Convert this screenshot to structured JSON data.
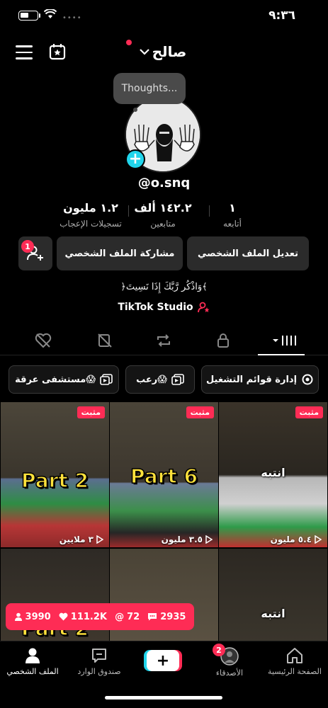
{
  "status_bar": {
    "time": "٩:٣٦"
  },
  "header": {
    "username": "صالح"
  },
  "profile": {
    "thought_bubble": "Thoughts...",
    "handle": "@o.snq",
    "bio": "﴿وَاذْكُر رَّبَّكَ إِذَا نَسِيتَ﴾",
    "studio": "TikTok Studio"
  },
  "stats": [
    {
      "value": "١",
      "label": "أتابعه"
    },
    {
      "value": "١٤٢.٢ ألف",
      "label": "متابعين"
    },
    {
      "value": "١.٢ مليون",
      "label": "تسجيلات الإعجاب"
    }
  ],
  "buttons": {
    "edit_profile": "تعديل الملف الشخصي",
    "share_profile": "مشاركة الملف الشخصي",
    "add_friend_badge": "1"
  },
  "playlists": {
    "manage": "إدارة قوائم التشغيل",
    "horror": "رعب😱",
    "hospital": "مستشفى عرقة😱"
  },
  "videos": [
    {
      "pinned": "مثبت",
      "overlay": "انتبه",
      "views": "٥.٤ مليون"
    },
    {
      "pinned": "مثبت",
      "overlay": "Part 6",
      "views": "٣.٥ مليون"
    },
    {
      "pinned": "مثبت",
      "overlay": "Part 2",
      "views": "٣ ملايين"
    },
    {
      "overlay": "انتبه"
    },
    {
      "overlay": ""
    },
    {
      "overlay": "Part 2"
    }
  ],
  "engagement": {
    "comments": "2935",
    "mentions": "72",
    "likes": "111.2K",
    "followers": "3990"
  },
  "nav": {
    "home": "الصفحة الرئيسية",
    "friends": "الأصدقاء",
    "friends_badge": "2",
    "inbox": "صندوق الوارد",
    "profile": "الملف الشخصي"
  },
  "colors": {
    "accent": "#fe2c55",
    "cyan": "#20d5ec",
    "bg": "#000000"
  }
}
